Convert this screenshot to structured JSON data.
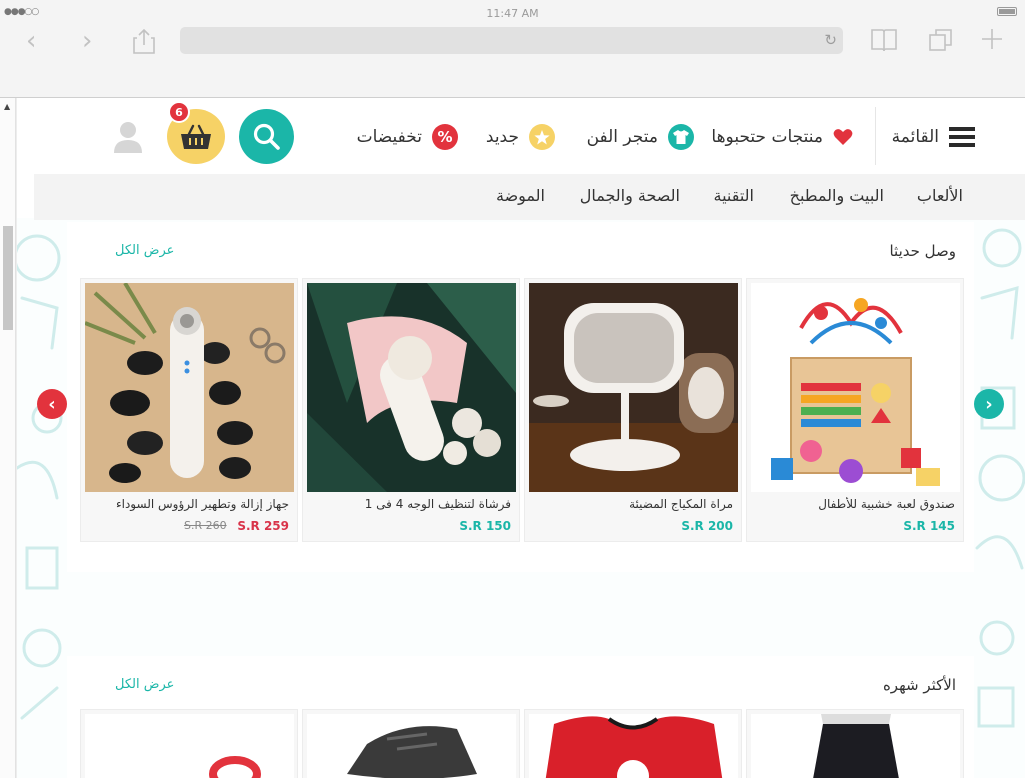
{
  "browser": {
    "status_dots": "●●●○○",
    "time": "11:47 AM",
    "icons": [
      "back-icon",
      "forward-icon",
      "share-icon",
      "reload-icon",
      "bookmarks-icon",
      "tabs-icon",
      "new-tab-icon"
    ]
  },
  "header": {
    "menu_label": "القائمة",
    "favorites_label": "منتجات حتحبوها",
    "art_store_label": "متجر الفن",
    "new_label": "جديد",
    "discounts_label": "تخفيضات",
    "cart_count": "6",
    "colors": {
      "teal": "#1bb6a8",
      "yellow": "#f6d266",
      "red": "#e2333d"
    }
  },
  "categories": {
    "games": "الألعاب",
    "home_kitchen": "البيت والمطبخ",
    "tech": "التقنية",
    "health_beauty": "الصحة والجمال",
    "fashion": "الموضة"
  },
  "new_arrivals": {
    "title": "وصل حديثا",
    "view_all": "عرض الكل",
    "products": [
      {
        "name": "صندوق لعبة خشبية للأطفال",
        "price": "S.R 145"
      },
      {
        "name": "مراة المكياج المضيئة",
        "price": "S.R 200"
      },
      {
        "name": "فرشاة لتنظيف الوجه 4 فى 1",
        "price": "S.R 150"
      },
      {
        "name": "جهاز إزالة وتطهير الرؤوس السوداء",
        "price": "S.R 259",
        "old_price": "S.R 260"
      }
    ]
  },
  "best_sellers": {
    "title": "الأكثر شهره",
    "view_all": "عرض الكل"
  }
}
